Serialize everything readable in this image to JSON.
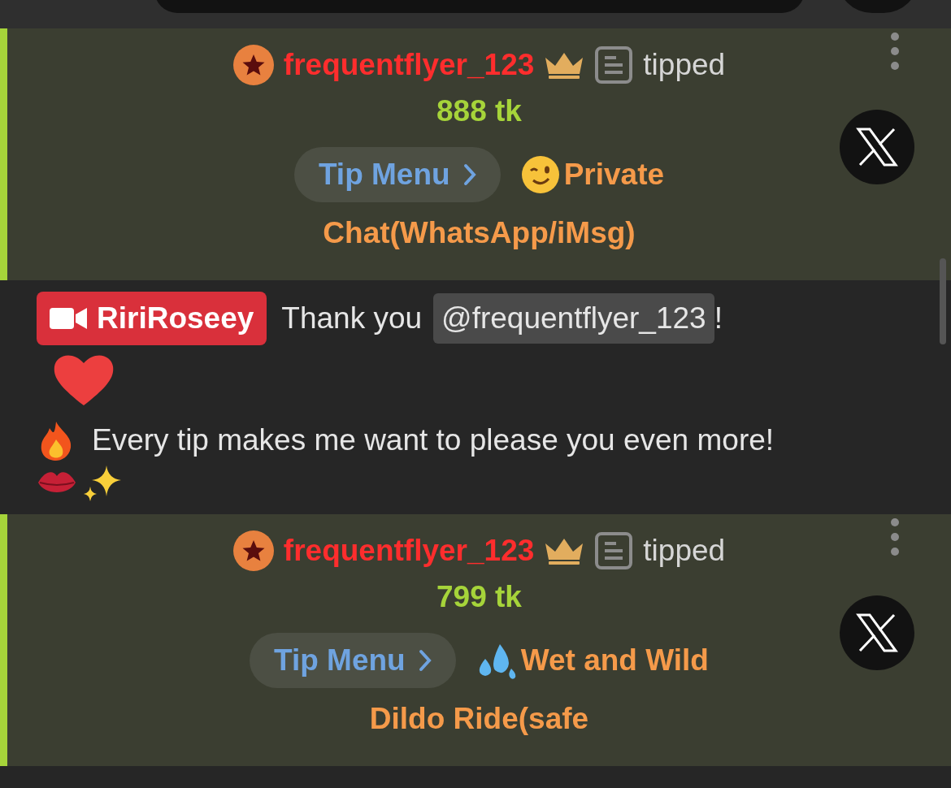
{
  "feed": [
    {
      "kind": "tip",
      "user": "frequentflyer_123",
      "action": "tipped",
      "amount": "888 tk",
      "menu_button": "Tip Menu",
      "item": {
        "kind": "wink",
        "lines": [
          "Private",
          "Chat(WhatsApp/iMsg)"
        ]
      }
    },
    {
      "kind": "message",
      "sender": "RiriRoseey",
      "text": "Thank you",
      "mention": "@frequentflyer_123",
      "text_after": "!",
      "line2": "Every tip makes me want to please you even more!"
    },
    {
      "kind": "tip",
      "user": "frequentflyer_123",
      "action": "tipped",
      "amount": "799 tk",
      "menu_button": "Tip Menu",
      "item": {
        "kind": "droplets",
        "lines": [
          "Wet and Wild",
          "Dildo Ride(safe"
        ]
      }
    }
  ]
}
